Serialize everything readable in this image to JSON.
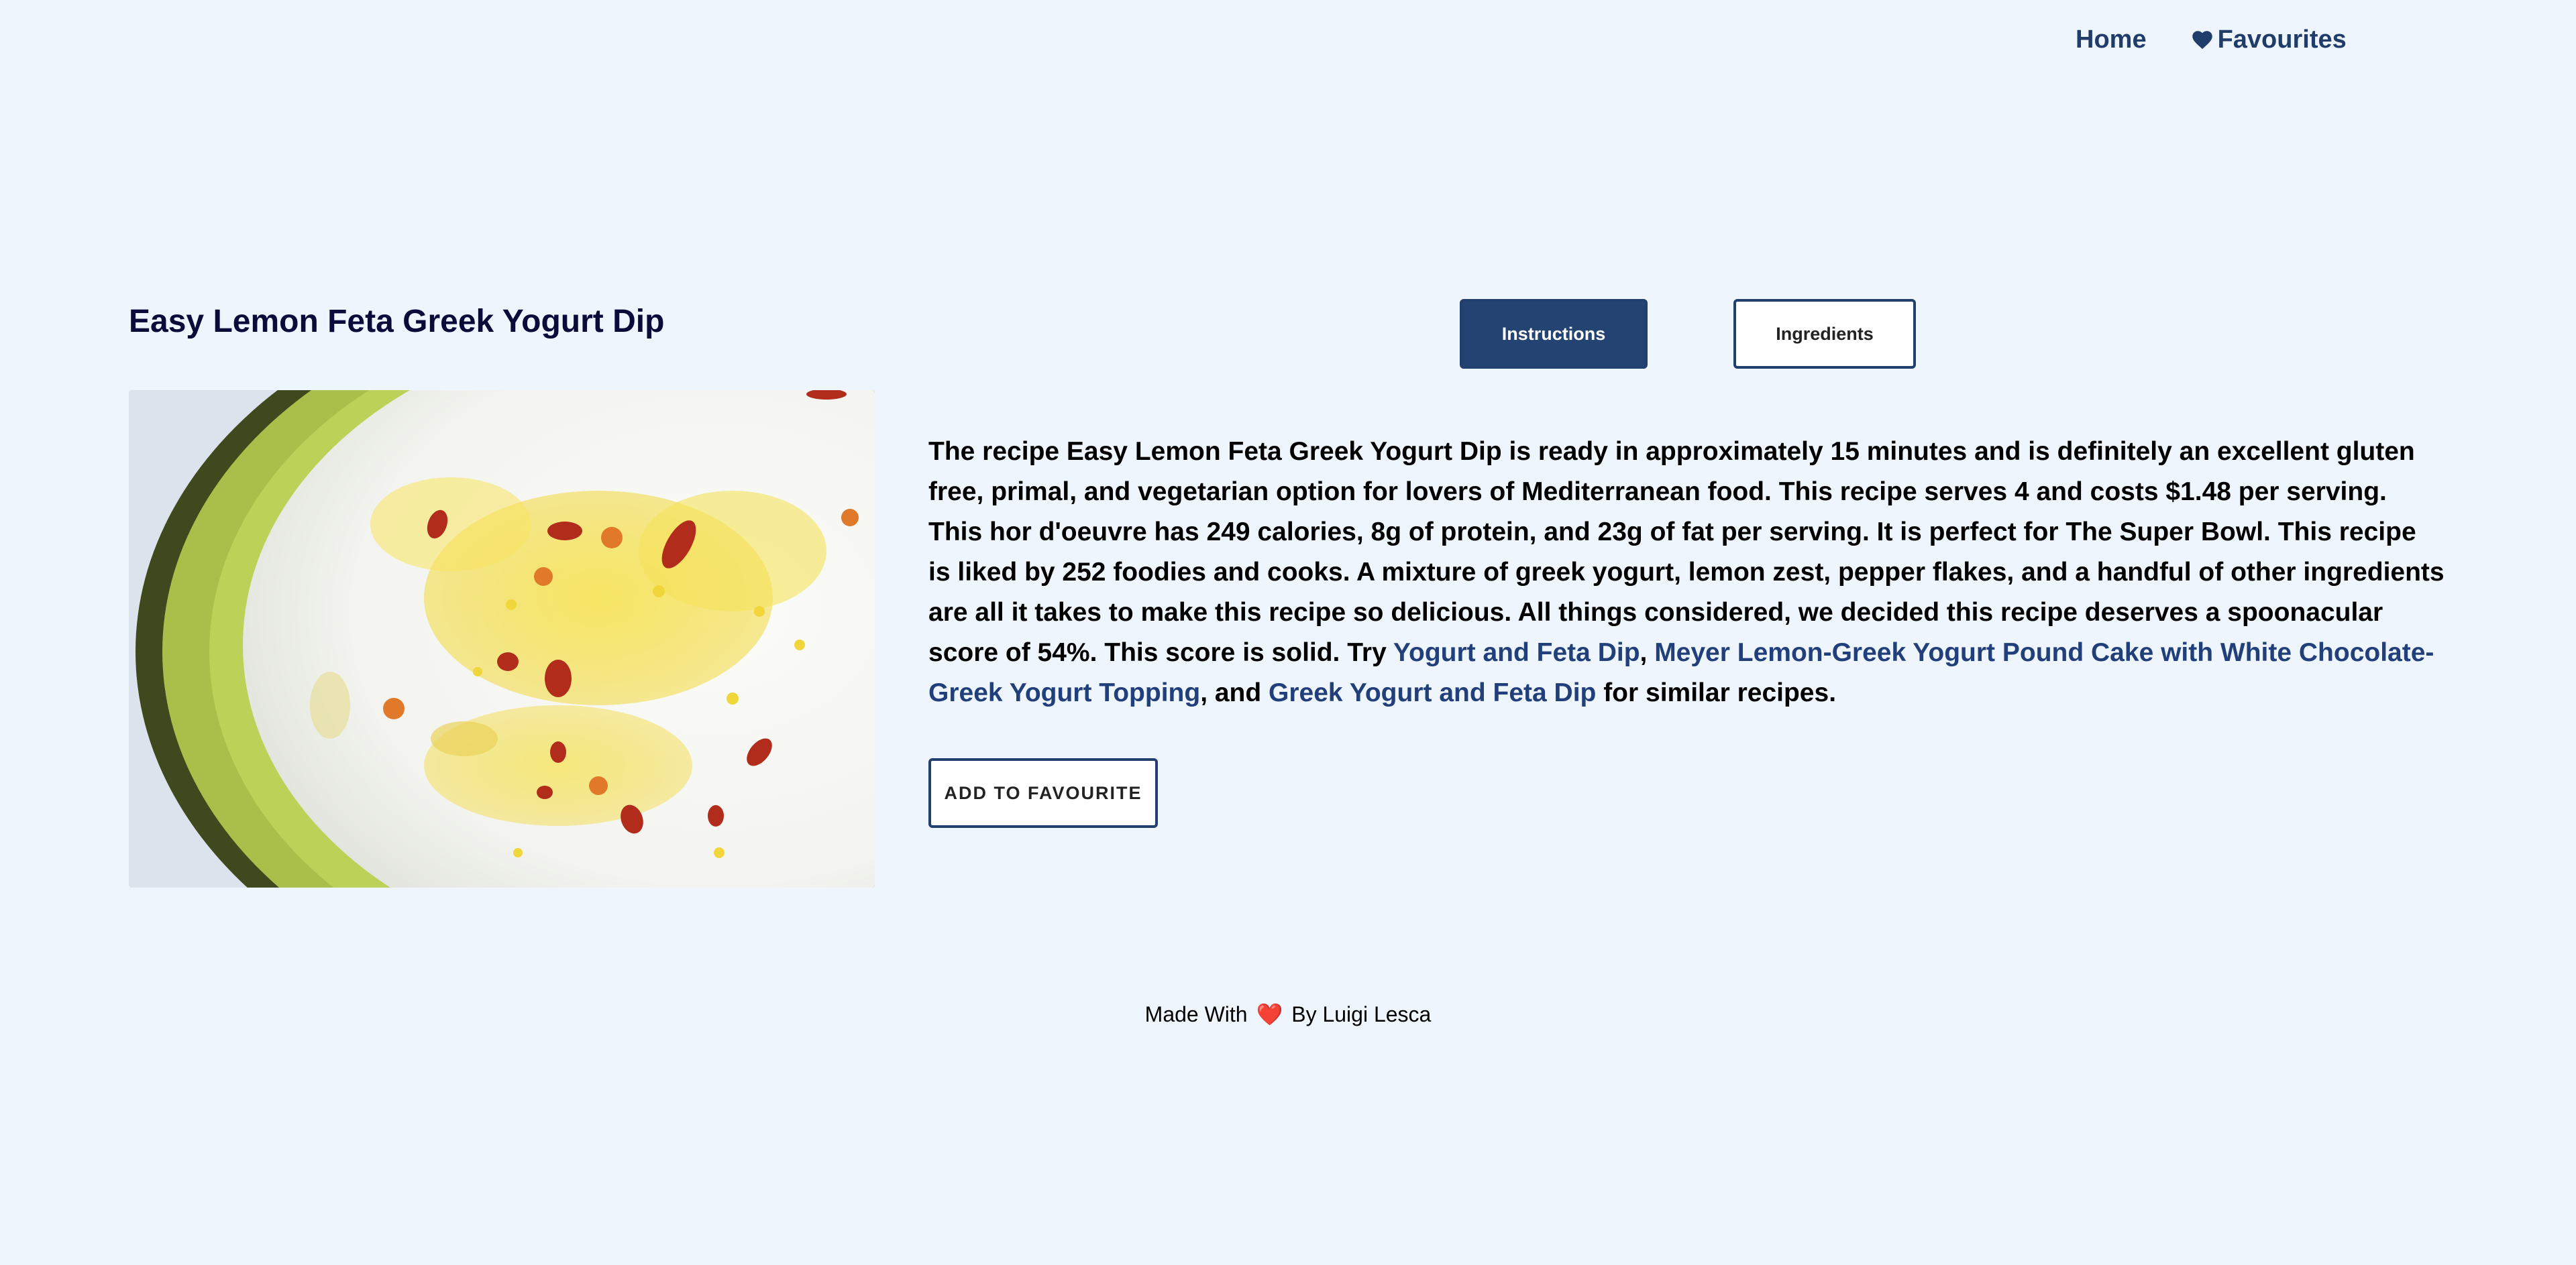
{
  "nav": {
    "home_label": "Home",
    "favourites_icon": "heart-icon",
    "favourites_label": "Favourites"
  },
  "recipe": {
    "title": "Easy Lemon Feta Greek Yogurt Dip",
    "image_alt": "Easy Lemon Feta Greek Yogurt Dip"
  },
  "tabs": {
    "instructions_label": "Instructions",
    "ingredients_label": "Ingredients",
    "active": "Instructions"
  },
  "summary": {
    "text_part1": "The recipe Easy Lemon Feta Greek Yogurt Dip is ready in approximately 15 minutes and is definitely an excellent gluten free, primal, and vegetarian option for lovers of Mediterranean food. This recipe serves 4 and costs $1.48 per serving. This hor d'oeuvre has 249 calories, 8g of protein, and 23g of fat per serving. It is perfect for The Super Bowl. This recipe is liked by 252 foodies and cooks. A mixture of greek yogurt, lemon zest, pepper flakes, and a handful of other ingredients are all it takes to make this recipe so delicious. All things considered, we decided this recipe deserves a spoonacular score of 54%. This score is solid. Try ",
    "link1": "Yogurt and Feta Dip",
    "sep1": ", ",
    "link2": "Meyer Lemon-Greek Yogurt Pound Cake with White Chocolate-Greek Yogurt Topping",
    "sep2": ", and ",
    "link3": "Greek Yogurt and Feta Dip",
    "text_end": " for similar recipes."
  },
  "actions": {
    "add_favourite_label": "ADD TO FAVOURITE"
  },
  "footer": {
    "prefix": "Made With",
    "heart": "❤️",
    "suffix": "By Luigi Lesca"
  },
  "colors": {
    "background": "#eff5fc",
    "primary": "#234473",
    "link": "#213f7a",
    "title": "#0b0b3b"
  }
}
